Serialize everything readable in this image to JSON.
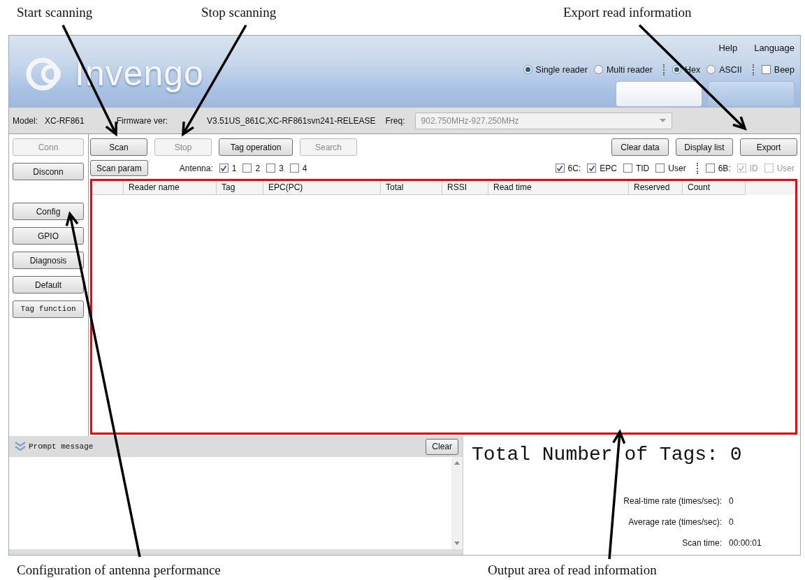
{
  "top_callouts": [
    "Start scanning",
    "Stop scanning",
    "Export read information"
  ],
  "app": {
    "logo": "Invengo",
    "menu": [
      "Help",
      "Language"
    ],
    "reader_modes": [
      {
        "label": "Single reader",
        "selected": true
      },
      {
        "label": "Multi reader",
        "selected": false
      }
    ],
    "encodings": [
      {
        "label": "Hex",
        "selected": true
      },
      {
        "label": "ASCII",
        "selected": false
      }
    ],
    "beep": {
      "label": "Beep",
      "checked": false
    },
    "info": {
      "model_label": "Model:",
      "model": "XC-RF861",
      "firmware_label": "Firmware ver:",
      "firmware": "V3.51US_861C,XC-RF861svn241-RELEASE",
      "freq_label": "Freq:",
      "freq": "902.750MHz-927.250MHz"
    },
    "sidebar": [
      {
        "label": "Conn",
        "disabled": true
      },
      {
        "label": "Disconn",
        "disabled": false
      },
      {
        "label": "Config",
        "disabled": false
      },
      {
        "label": "GPIO",
        "disabled": false
      },
      {
        "label": "Diagnosis",
        "disabled": false
      },
      {
        "label": "Default",
        "disabled": false
      },
      {
        "label": "Tag function",
        "disabled": false
      }
    ],
    "toolbar_left": [
      {
        "label": "Scan",
        "disabled": false
      },
      {
        "label": "Stop",
        "disabled": true
      },
      {
        "label": "Tag operation",
        "disabled": false
      },
      {
        "label": "Search",
        "disabled": true
      }
    ],
    "toolbar_right": [
      {
        "label": "Clear data",
        "disabled": false
      },
      {
        "label": "Display list",
        "disabled": false
      },
      {
        "label": "Export",
        "disabled": false
      }
    ],
    "scan_param": "Scan param",
    "antenna_label": "Antenna:",
    "antennas": [
      {
        "label": "1",
        "checked": true
      },
      {
        "label": "2",
        "checked": false
      },
      {
        "label": "3",
        "checked": false
      },
      {
        "label": "4",
        "checked": false
      }
    ],
    "filters_6c": [
      {
        "label": "6C:",
        "checked": true,
        "disabled": false
      },
      {
        "label": "EPC",
        "checked": true,
        "disabled": false
      },
      {
        "label": "TID",
        "checked": false,
        "disabled": false
      },
      {
        "label": "User",
        "checked": false,
        "disabled": false
      }
    ],
    "filters_6b": [
      {
        "label": "6B:",
        "checked": false,
        "disabled": false
      },
      {
        "label": "ID",
        "checked": true,
        "disabled": true
      },
      {
        "label": "User",
        "checked": false,
        "disabled": true
      }
    ],
    "table": {
      "columns": [
        "Reader name",
        "Tag",
        "EPC(PC)",
        "Total",
        "RSSI",
        "Read time",
        "Reserved",
        "Count"
      ]
    },
    "prompt": {
      "title": "Prompt message",
      "clear": "Clear"
    },
    "stats": {
      "total_label": "Total Number of Tags:",
      "total": "0",
      "rates": [
        {
          "label": "Real-time rate (times/sec):",
          "value": "0"
        },
        {
          "label": "Average rate (times/sec):",
          "value": "0"
        },
        {
          "label": "Scan time:",
          "value": "00:00:01"
        }
      ]
    }
  },
  "bottom_callouts": [
    "Configuration of antenna performance",
    "Output area of read information"
  ]
}
